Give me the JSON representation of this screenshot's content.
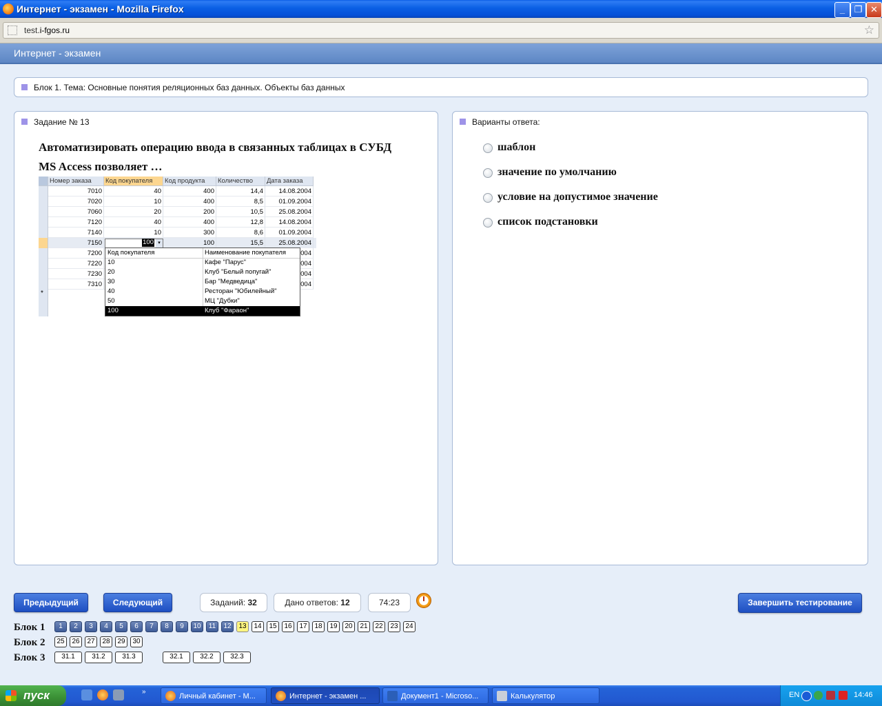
{
  "window": {
    "title": "Интернет - экзамен - Mozilla Firefox"
  },
  "address_bar": {
    "url_prefix": "test.",
    "url_domain": "i-fgos.ru"
  },
  "page": {
    "header": "Интернет - экзамен",
    "block_title": "Блок 1. Тема: Основные понятия реляционных баз данных. Объекты баз данных",
    "task_title": "Задание № 13",
    "question_line1": "Автоматизировать операцию ввода в связанных таблицах в СУБД",
    "question_line2": "MS Access позволяет …",
    "answers_title": "Варианты ответа:",
    "answers": [
      "шаблон",
      "значение по умолчанию",
      "условие на допустимое значение",
      "список подстановки"
    ]
  },
  "access_table": {
    "headers": [
      "Номер заказа",
      "Код покупателя",
      "Код продукта",
      "Количество",
      "Дата заказа"
    ],
    "rows": [
      [
        "7010",
        "40",
        "400",
        "14,4",
        "14.08.2004"
      ],
      [
        "7020",
        "10",
        "400",
        "8,5",
        "01.09.2004"
      ],
      [
        "7060",
        "20",
        "200",
        "10,5",
        "25.08.2004"
      ],
      [
        "7120",
        "40",
        "400",
        "12,8",
        "14.08.2004"
      ],
      [
        "7140",
        "10",
        "300",
        "8,6",
        "01.09.2004"
      ],
      [
        "7150",
        "100",
        "100",
        "15,5",
        "25.08.2004"
      ],
      [
        "7200",
        "",
        "",
        "",
        "2004"
      ],
      [
        "7220",
        "",
        "",
        "",
        "2004"
      ],
      [
        "7230",
        "",
        "",
        "",
        "2004"
      ],
      [
        "7310",
        "",
        "",
        "",
        "2004"
      ]
    ],
    "new_row_marker": "*",
    "dropdown_headers": [
      "Код покупателя",
      "Наименование покупателя"
    ],
    "dropdown_rows": [
      [
        "10",
        "Кафе \"Парус\""
      ],
      [
        "20",
        "Клуб \"Белый попугай\""
      ],
      [
        "30",
        "Бар \"Медведица\""
      ],
      [
        "40",
        "Ресторан \"Юбилейный\""
      ],
      [
        "50",
        "МЦ \"Дубки\""
      ],
      [
        "100",
        "Клуб \"Фараон\""
      ]
    ]
  },
  "controls": {
    "prev_label": "Предыдущий",
    "next_label": "Следующий",
    "tasks_label": "Заданий:",
    "tasks_value": "32",
    "answered_label": "Дано ответов:",
    "answered_value": "12",
    "timer": "74:23",
    "finish_label": "Завершить тестирование"
  },
  "blocks": [
    {
      "label": "Блок 1",
      "items": [
        "1",
        "2",
        "3",
        "4",
        "5",
        "6",
        "7",
        "8",
        "9",
        "10",
        "11",
        "12",
        "13",
        "14",
        "15",
        "16",
        "17",
        "18",
        "19",
        "20",
        "21",
        "22",
        "23",
        "24"
      ]
    },
    {
      "label": "Блок 2",
      "items": [
        "25",
        "26",
        "27",
        "28",
        "29",
        "30"
      ]
    },
    {
      "label": "Блок 3",
      "items": [
        "31.1",
        "31.2",
        "31.3",
        "32.1",
        "32.2",
        "32.3"
      ]
    }
  ],
  "taskbar": {
    "start_label": "пуск",
    "tasks": [
      "Личный кабинет - M...",
      "Интернет - экзамен ...",
      "Документ1 - Microso...",
      "Калькулятор"
    ],
    "lang": "EN",
    "clock": "14:46"
  }
}
